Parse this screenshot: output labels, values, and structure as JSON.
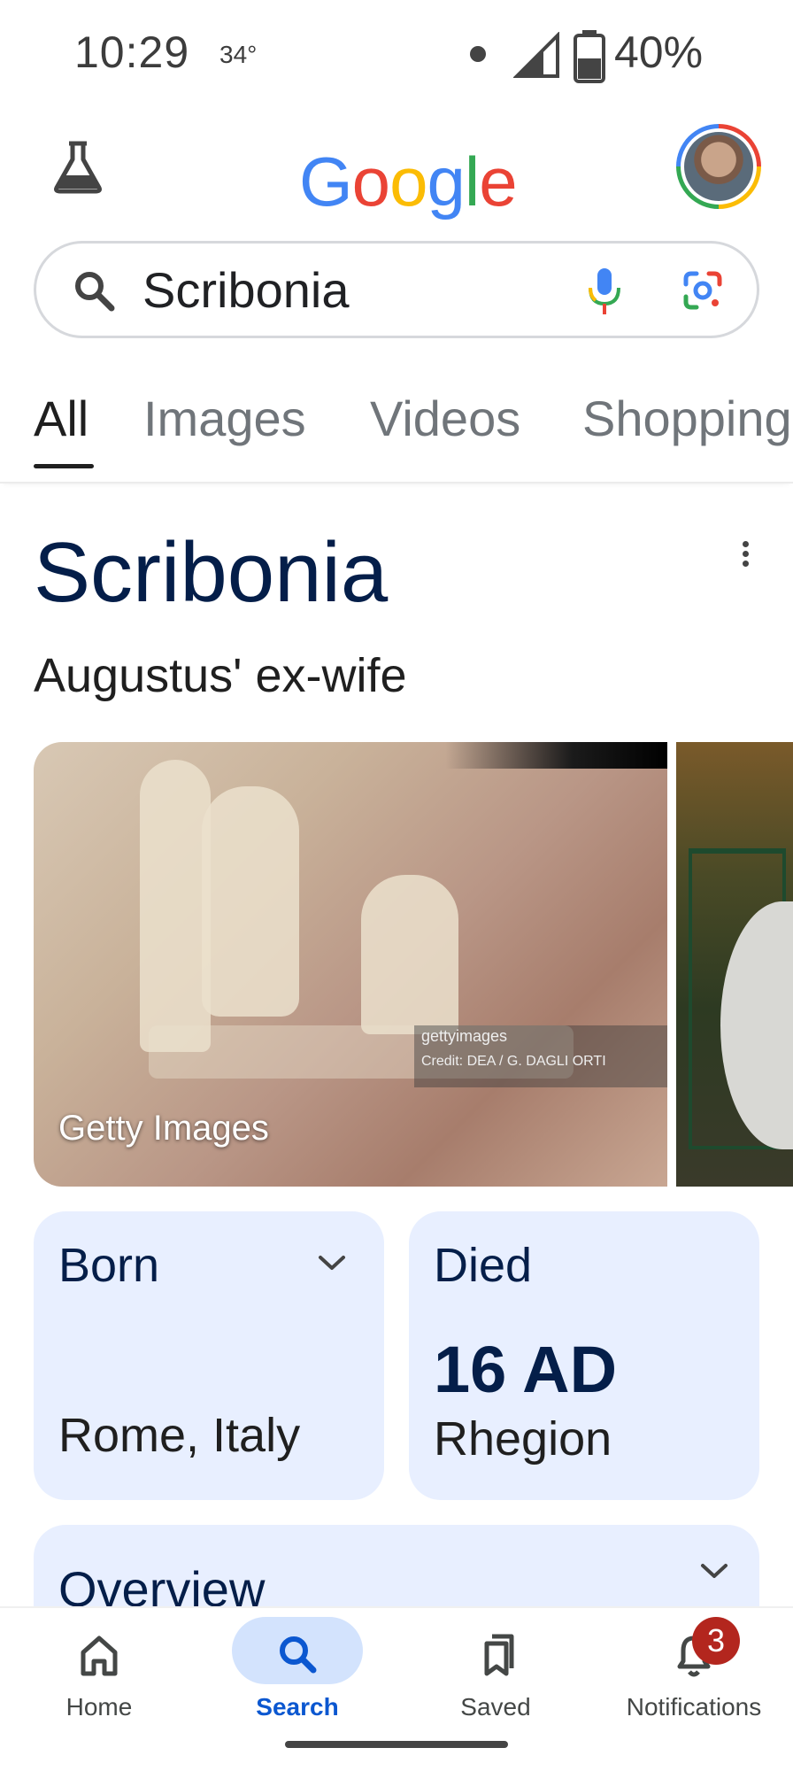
{
  "status_bar": {
    "time": "10:29",
    "temperature": "34°",
    "battery_percent": "40%"
  },
  "header": {
    "logo_letters": [
      "G",
      "o",
      "o",
      "g",
      "l",
      "e"
    ],
    "logo_colors": [
      "#4285f4",
      "#ea4335",
      "#fbbc05",
      "#4285f4",
      "#34a853",
      "#ea4335"
    ],
    "lab_icon": "flask-icon",
    "avatar_icon": "user-avatar"
  },
  "search": {
    "query": "Scribonia",
    "search_icon": "search-icon",
    "mic_icon": "mic-icon",
    "lens_icon": "lens-camera-icon"
  },
  "tabs": [
    {
      "label": "All",
      "active": true
    },
    {
      "label": "Images",
      "active": false
    },
    {
      "label": "Videos",
      "active": false
    },
    {
      "label": "Shopping",
      "active": false
    }
  ],
  "knowledge_panel": {
    "title": "Scribonia",
    "subtitle": "Augustus' ex-wife",
    "image_caption": "Getty Images",
    "image_watermark_line1": "gettyimages",
    "image_watermark_line2": "Credit: DEA / G. DAGLI ORTI",
    "born": {
      "label": "Born",
      "value": "Rome, Italy"
    },
    "died": {
      "label": "Died",
      "year": "16 AD",
      "place": "Rhegion"
    },
    "overview_label": "Overview"
  },
  "bottom_nav": {
    "items": [
      {
        "label": "Home",
        "icon": "home-icon"
      },
      {
        "label": "Search",
        "icon": "search-icon",
        "active": true
      },
      {
        "label": "Saved",
        "icon": "bookmarks-icon"
      },
      {
        "label": "Notifications",
        "icon": "bell-icon"
      }
    ],
    "notification_count": "3"
  },
  "colors": {
    "accent_blue": "#0b57d0",
    "card_bg": "#e8efff",
    "title_navy": "#041e49",
    "badge_red": "#b3261e"
  }
}
